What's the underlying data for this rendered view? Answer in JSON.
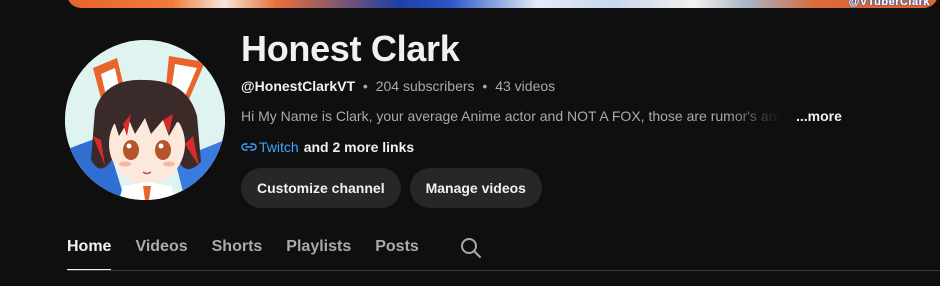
{
  "banner": {
    "watermark_text": "@VTuberClark"
  },
  "channel": {
    "name": "Honest Clark",
    "handle": "@HonestClarkVT",
    "subscribers": "204 subscribers",
    "videos": "43 videos",
    "separator": "•",
    "description": "Hi My Name is Clark, your average Anime actor and NOT A FOX, those are rumor's and",
    "more_label": "...more",
    "link_label": "Twitch",
    "more_links": "and 2 more links"
  },
  "buttons": {
    "customize": "Customize channel",
    "manage": "Manage videos"
  },
  "tabs": [
    {
      "label": "Home",
      "active": true
    },
    {
      "label": "Videos",
      "active": false
    },
    {
      "label": "Shorts",
      "active": false
    },
    {
      "label": "Playlists",
      "active": false
    },
    {
      "label": "Posts",
      "active": false
    }
  ],
  "icons": {
    "link": "link-icon",
    "search": "search-icon"
  },
  "colors": {
    "background": "#0f0f0f",
    "button_bg": "#272727",
    "link_blue": "#3ea6ff",
    "muted_text": "#aaaaaa",
    "primary_text": "#f1f1f1"
  }
}
